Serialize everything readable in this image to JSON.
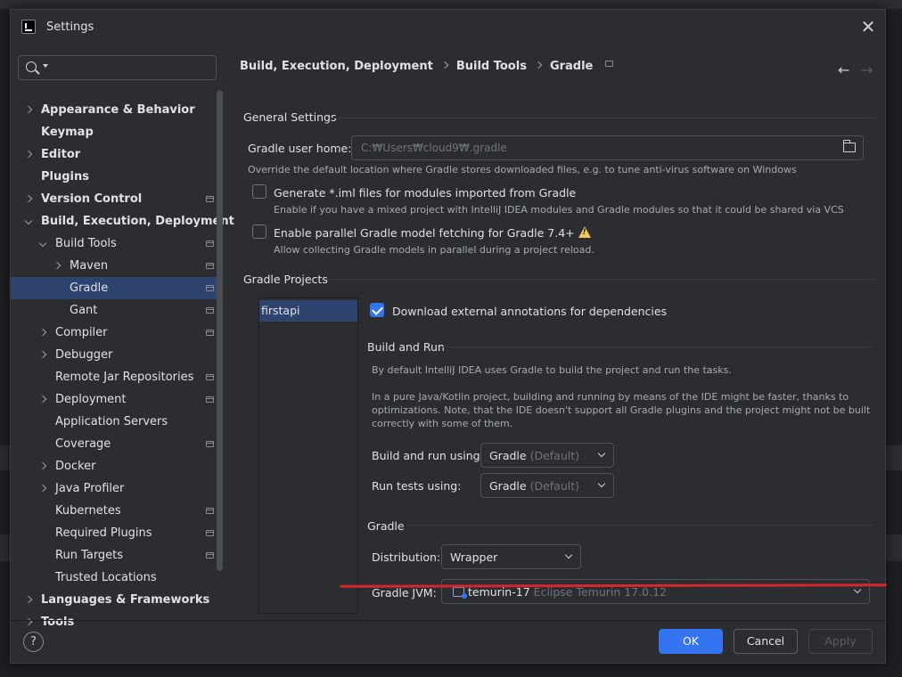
{
  "window": {
    "title": "Settings"
  },
  "search": {
    "placeholder": ""
  },
  "sidebar": {
    "items": [
      {
        "label": "Appearance & Behavior"
      },
      {
        "label": "Keymap"
      },
      {
        "label": "Editor"
      },
      {
        "label": "Plugins"
      },
      {
        "label": "Version Control"
      },
      {
        "label": "Build, Execution, Deployment"
      },
      {
        "label": "Build Tools"
      },
      {
        "label": "Maven"
      },
      {
        "label": "Gradle"
      },
      {
        "label": "Gant"
      },
      {
        "label": "Compiler"
      },
      {
        "label": "Debugger"
      },
      {
        "label": "Remote Jar Repositories"
      },
      {
        "label": "Deployment"
      },
      {
        "label": "Application Servers"
      },
      {
        "label": "Coverage"
      },
      {
        "label": "Docker"
      },
      {
        "label": "Java Profiler"
      },
      {
        "label": "Kubernetes"
      },
      {
        "label": "Required Plugins"
      },
      {
        "label": "Run Targets"
      },
      {
        "label": "Trusted Locations"
      },
      {
        "label": "Languages & Frameworks"
      },
      {
        "label": "Tools"
      }
    ]
  },
  "breadcrumb": [
    "Build, Execution, Deployment",
    "Build Tools",
    "Gradle"
  ],
  "general": {
    "title": "General Settings",
    "user_home_label": "Gradle user home:",
    "user_home_value": "C:₩Users₩cloud9₩.gradle",
    "user_home_hint": "Override the default location where Gradle stores downloaded files, e.g. to tune anti-virus software on Windows",
    "iml_label": "Generate *.iml files for modules imported from Gradle",
    "iml_hint": "Enable if you have a mixed project with IntelliJ IDEA modules and Gradle modules so that it could be shared via VCS",
    "parallel_label": "Enable parallel Gradle model fetching for Gradle 7.4+",
    "parallel_hint": "Allow collecting Gradle models in parallel during a project reload."
  },
  "projects": {
    "title": "Gradle Projects",
    "list": [
      "firstapi"
    ],
    "download_annotations_label": "Download external annotations for dependencies",
    "build_run_title": "Build and Run",
    "build_run_desc1": "By default IntelliJ IDEA uses Gradle to build the project and run the tasks.",
    "build_run_desc2a": "In a pure Java/Kotlin project, building and running by means of the IDE might be faster, thanks to",
    "build_run_desc2b": "optimizations. Note, that the IDE doesn't support all Gradle plugins and the project might not be built",
    "build_run_desc2c": "correctly with some of them.",
    "build_using_label": "Build and run using:",
    "build_using_value": "Gradle",
    "build_using_suffix": "(Default)",
    "tests_using_label": "Run tests using:",
    "tests_using_value": "Gradle",
    "tests_using_suffix": "(Default)",
    "gradle_title": "Gradle",
    "distribution_label": "Distribution:",
    "distribution_value": "Wrapper",
    "jvm_label": "Gradle JVM:",
    "jvm_value": "temurin-17",
    "jvm_detail": "Eclipse Temurin 17.0.12"
  },
  "footer": {
    "help": "?",
    "ok": "OK",
    "cancel": "Cancel",
    "apply": "Apply"
  },
  "colors": {
    "accent": "#3574f0",
    "selection": "#2e436e",
    "annotation": "#d7262c",
    "warning": "#f2c55c"
  }
}
